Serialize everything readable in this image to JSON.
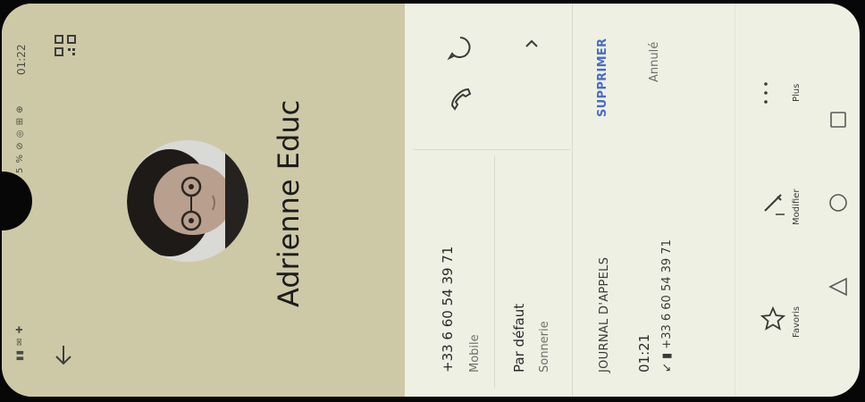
{
  "status_bar": {
    "time": "01:22",
    "battery": "5 %"
  },
  "contact": {
    "name": "Adrienne Educ"
  },
  "phone": {
    "number": "+33 6 60 54 39 71",
    "type": "Mobile"
  },
  "ringtone": {
    "value": "Par défaut",
    "label": "Sonnerie"
  },
  "call_log": {
    "title": "JOURNAL D'APPELS",
    "delete_label": "SUPPRIMER",
    "cancel_label": "Annulé",
    "entries": [
      {
        "time": "01:21",
        "number": "+33 6 60 54 39 71"
      }
    ]
  },
  "toolbar": {
    "favorites_label": "Favoris",
    "edit_label": "Modifier",
    "more_label": "Plus"
  },
  "icons": {
    "qr": "qr-code-icon",
    "back": "arrow-down-icon",
    "call": "phone-icon",
    "message": "message-icon",
    "expand": "chevron-icon",
    "favorite": "star-icon",
    "edit": "pencil-icon",
    "more": "more-dots-icon"
  }
}
